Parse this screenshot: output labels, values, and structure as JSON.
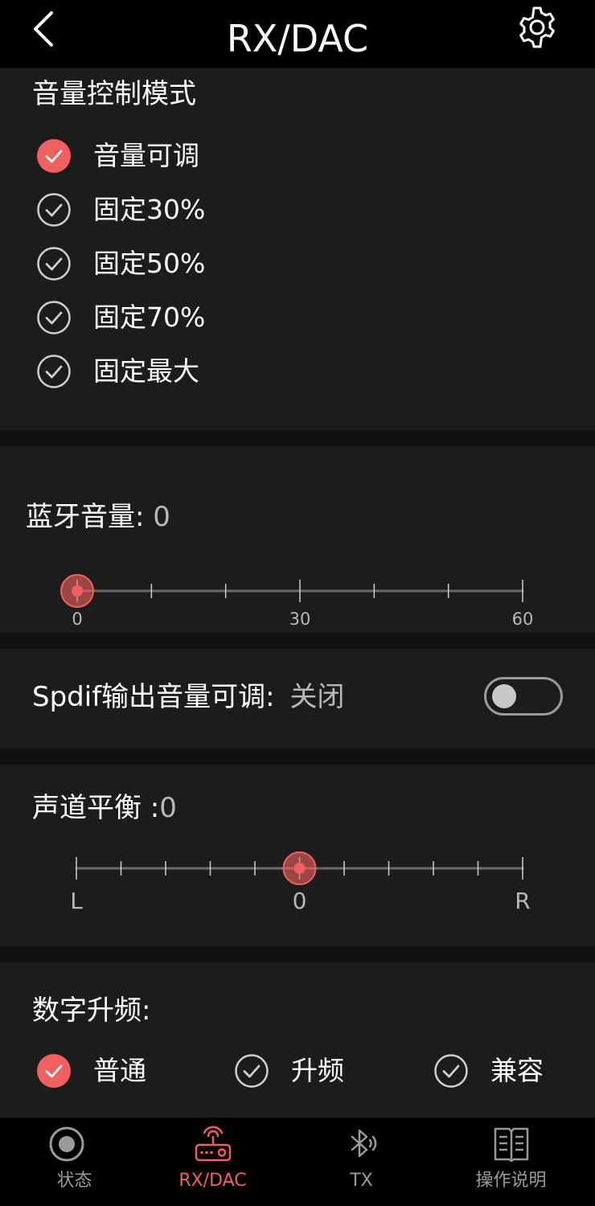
{
  "header": {
    "title": "RX/DAC",
    "back_icon": "chevron-left-icon",
    "settings_icon": "gear-icon"
  },
  "colors": {
    "accent": "#f06060",
    "background": "#111111",
    "panel": "#1c1c1c",
    "bar": "#000000",
    "muted": "#9a9a9a"
  },
  "volume_mode": {
    "title": "音量控制模式",
    "options": [
      {
        "label": "音量可调",
        "checked": true
      },
      {
        "label": "固定30%",
        "checked": false
      },
      {
        "label": "固定50%",
        "checked": false
      },
      {
        "label": "固定70%",
        "checked": false
      },
      {
        "label": "固定最大",
        "checked": false
      }
    ]
  },
  "bluetooth_volume": {
    "label": "蓝牙音量:",
    "value": "0",
    "slider": {
      "min": 0,
      "max": 60,
      "value": 0,
      "tick_labels": [
        "0",
        "30",
        "60"
      ]
    }
  },
  "spdif": {
    "label": "Spdif输出音量可调:",
    "state_text": "关闭",
    "enabled": false
  },
  "channel_balance": {
    "label": "声道平衡 :",
    "value": "0",
    "slider": {
      "min": -5,
      "max": 5,
      "value": 0,
      "tick_labels": [
        "L",
        "0",
        "R"
      ]
    }
  },
  "digital_upsample": {
    "title": "数字升频:",
    "options": [
      {
        "label": "普通",
        "checked": true
      },
      {
        "label": "升频",
        "checked": false
      },
      {
        "label": "兼容",
        "checked": false
      }
    ]
  },
  "tabs": [
    {
      "label": "状态",
      "icon": "status-record-icon",
      "active": false
    },
    {
      "label": "RX/DAC",
      "icon": "radio-receiver-icon",
      "active": true
    },
    {
      "label": "TX",
      "icon": "bluetooth-icon",
      "active": false
    },
    {
      "label": "操作说明",
      "icon": "manual-book-icon",
      "active": false
    }
  ]
}
